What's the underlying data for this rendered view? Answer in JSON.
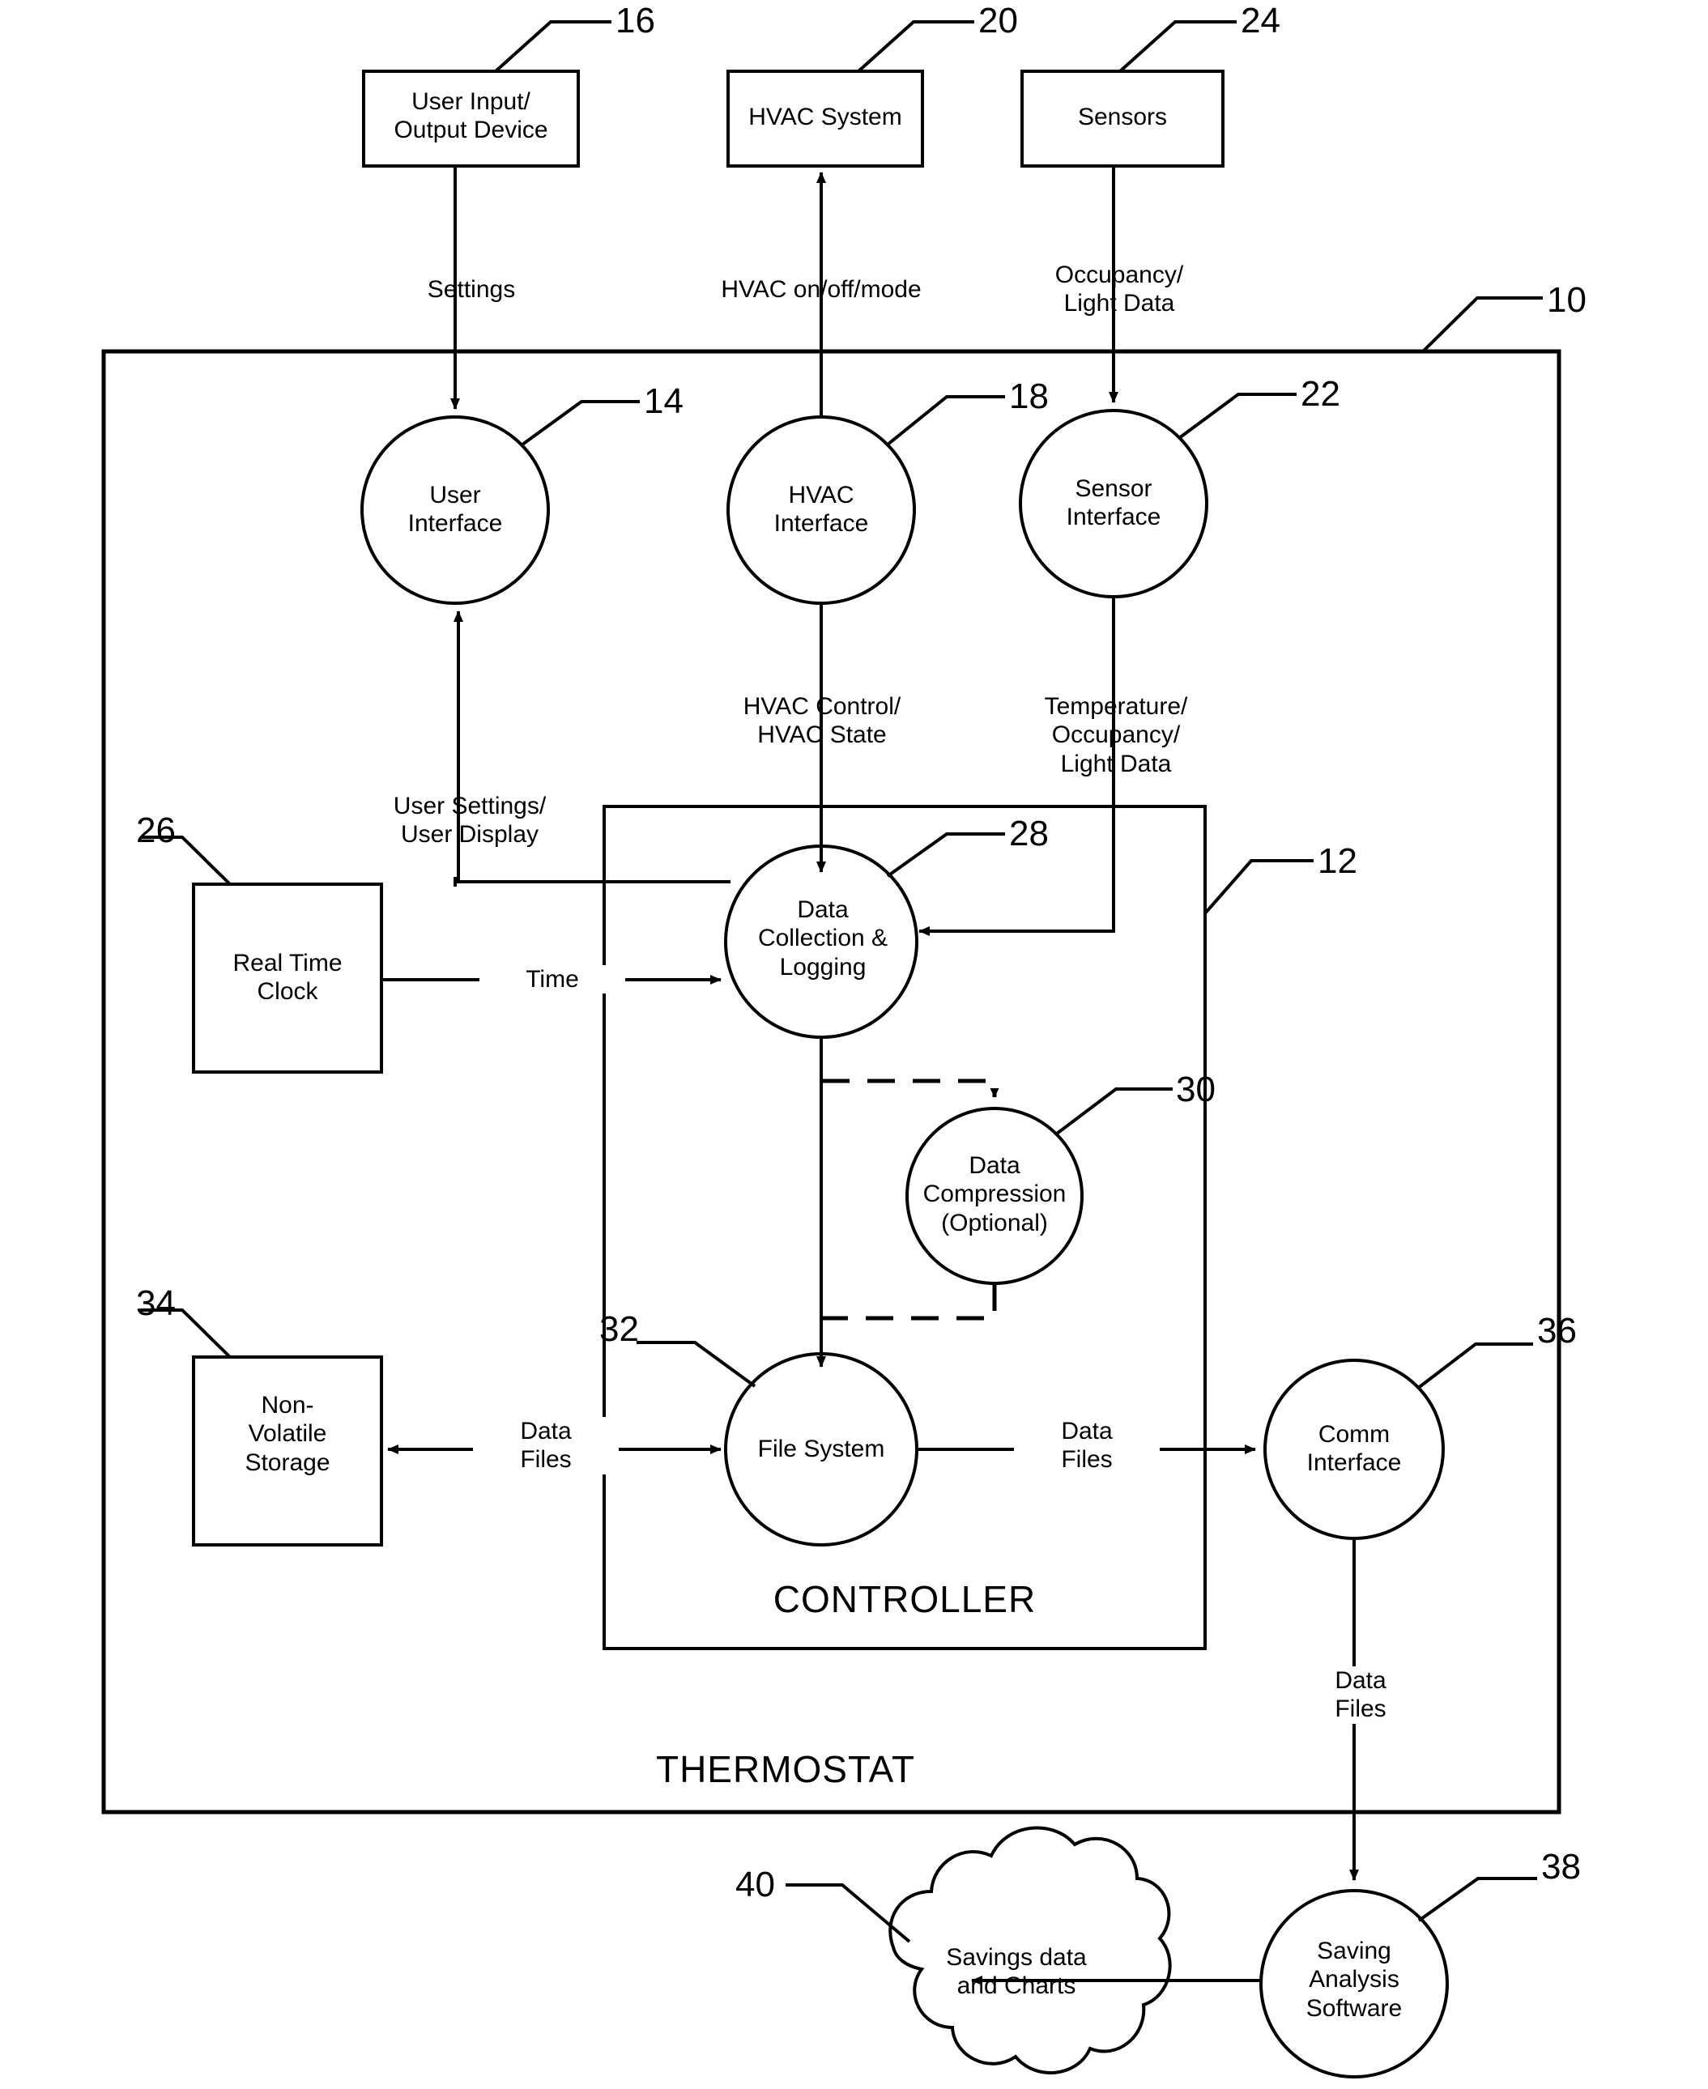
{
  "figure": {
    "title": "Thermostat data collection and savings analysis block diagram",
    "outer_container_label": "THERMOSTAT",
    "inner_container_label": "CONTROLLER"
  },
  "boxes": [
    {
      "id": "user-io",
      "label": "User Input/\nOutput Device",
      "ref": "16"
    },
    {
      "id": "hvac-system",
      "label": "HVAC System",
      "ref": "20"
    },
    {
      "id": "sensors",
      "label": "Sensors",
      "ref": "24"
    },
    {
      "id": "real-time-clock",
      "label": "Real Time\nClock",
      "ref": "26"
    },
    {
      "id": "non-volatile-storage",
      "label": "Non-\nVolatile\nStorage",
      "ref": "34"
    }
  ],
  "circles": [
    {
      "id": "user-interface",
      "label": "User\nInterface",
      "ref": "14"
    },
    {
      "id": "hvac-interface",
      "label": "HVAC\nInterface",
      "ref": "18"
    },
    {
      "id": "sensor-interface",
      "label": "Sensor\nInterface",
      "ref": "22"
    },
    {
      "id": "data-collection-logging",
      "label": "Data\nCollection &\nLogging",
      "ref": "28"
    },
    {
      "id": "data-compression",
      "label": "Data\nCompression\n(Optional)",
      "ref": "30"
    },
    {
      "id": "file-system",
      "label": "File System",
      "ref": "32"
    },
    {
      "id": "comm-interface",
      "label": "Comm\nInterface",
      "ref": "36"
    },
    {
      "id": "saving-analysis-software",
      "label": "Saving\nAnalysis\nSoftware",
      "ref": "38"
    }
  ],
  "cloud": {
    "id": "savings-data-and-charts",
    "label": "Savings data\nand Charts",
    "ref": "40"
  },
  "containers": [
    {
      "id": "thermostat",
      "label": "THERMOSTAT",
      "ref": "10"
    },
    {
      "id": "controller",
      "label": "CONTROLLER",
      "ref": "12"
    }
  ],
  "flow_labels": [
    {
      "id": "settings",
      "text": "Settings"
    },
    {
      "id": "hvac-on-off-mode",
      "text": "HVAC on/off/mode"
    },
    {
      "id": "occupancy-light-data",
      "text": "Occupancy/\nLight Data"
    },
    {
      "id": "hvac-control-state",
      "text": "HVAC Control/\nHVAC State"
    },
    {
      "id": "temperature-occupancy-light-data",
      "text": "Temperature/\nOccupancy/\nLight Data"
    },
    {
      "id": "user-settings-display",
      "text": "User Settings/\nUser Display"
    },
    {
      "id": "time",
      "text": "Time"
    },
    {
      "id": "data-files-storage",
      "text": "Data\nFiles"
    },
    {
      "id": "data-files-comm",
      "text": "Data\nFiles"
    },
    {
      "id": "data-files-out",
      "text": "Data\nFiles"
    }
  ],
  "reference_numerals": [
    "10",
    "12",
    "14",
    "16",
    "18",
    "20",
    "22",
    "24",
    "26",
    "28",
    "30",
    "32",
    "34",
    "36",
    "38",
    "40"
  ],
  "colors": {
    "stroke": "#000000",
    "background": "#ffffff"
  }
}
